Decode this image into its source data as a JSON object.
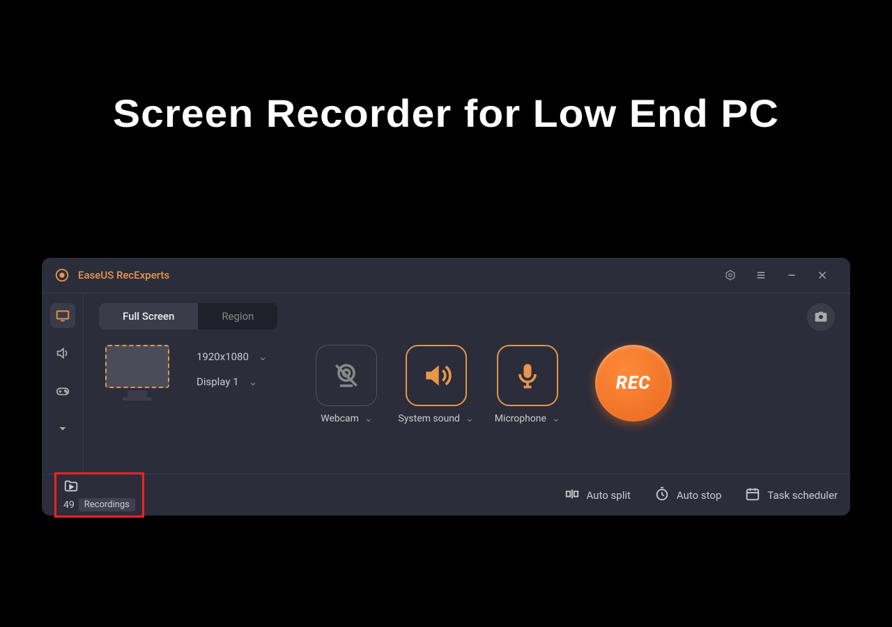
{
  "hero_title": "Screen Recorder for Low End PC",
  "app_title": "EaseUS RecExperts",
  "tabs": {
    "full_screen": "Full Screen",
    "region": "Region"
  },
  "resolution": "1920x1080",
  "display": "Display 1",
  "sources": {
    "webcam": "Webcam",
    "system_sound": "System sound",
    "microphone": "Microphone"
  },
  "rec_button": "REC",
  "recordings": {
    "count": "49",
    "label": "Recordings"
  },
  "footer": {
    "auto_split": "Auto split",
    "auto_stop": "Auto stop",
    "task_scheduler": "Task scheduler"
  }
}
